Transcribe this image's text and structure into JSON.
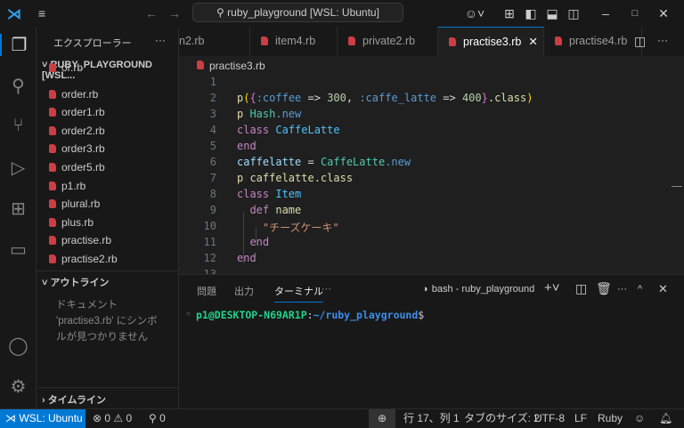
{
  "titlebar": {
    "search": "ruby_playground [WSL: Ubuntu]"
  },
  "sidebar": {
    "title": "エクスプローラー",
    "more": "···",
    "folder": "RUBY_PLAYGROUND [WSL...",
    "files": [
      "or.rb",
      "order.rb",
      "order1.rb",
      "order2.rb",
      "order3.rb",
      "order5.rb",
      "p1.rb",
      "plural.rb",
      "plus.rb",
      "practise.rb",
      "practise2.rb"
    ],
    "outline_title": "アウトライン",
    "outline_msg": [
      "ドキュメント",
      "'practise3.rb' にシンボ",
      "ルが見つかりません"
    ],
    "timeline_title": "タイムライン"
  },
  "tabs": [
    {
      "label": "n2.rb",
      "icon": false
    },
    {
      "label": "item4.rb",
      "icon": true
    },
    {
      "label": "private2.rb",
      "icon": true
    },
    {
      "label": "practise3.rb",
      "icon": true,
      "active": true
    },
    {
      "label": "practise4.rb",
      "icon": true
    }
  ],
  "breadcrumb": "practise3.rb",
  "code": [
    [],
    [
      [
        "p",
        "#dcdcaa"
      ],
      [
        "(",
        "#ffd700"
      ],
      [
        "{",
        "#da70d6"
      ],
      [
        ":coffee",
        "#569cd6"
      ],
      [
        " => ",
        "#d4d4d4"
      ],
      [
        "300",
        "#b5cea8"
      ],
      [
        ", ",
        "#d4d4d4"
      ],
      [
        ":caffe_latte",
        "#569cd6"
      ],
      [
        " => ",
        "#d4d4d4"
      ],
      [
        "400",
        "#b5cea8"
      ],
      [
        "}",
        "#da70d6"
      ],
      [
        ".class",
        "#dcdcaa"
      ],
      [
        ")",
        "#ffd700"
      ]
    ],
    [
      [
        "p ",
        "#dcdcaa"
      ],
      [
        "Hash",
        "#4ec9b0"
      ],
      [
        ".new",
        "#569cd6"
      ]
    ],
    [
      [
        "class ",
        "#c586c0"
      ],
      [
        "CaffeLatte",
        "#4fc1ff"
      ]
    ],
    [
      [
        "end",
        "#c586c0"
      ]
    ],
    [
      [
        "caffelatte",
        "#9cdcfe"
      ],
      [
        " = ",
        "#d4d4d4"
      ],
      [
        "CaffeLatte",
        "#4ec9b0"
      ],
      [
        ".new",
        "#569cd6"
      ]
    ],
    [
      [
        "p caffelatte.class",
        "#dcdcaa"
      ]
    ],
    [
      [
        "class ",
        "#c586c0"
      ],
      [
        "Item",
        "#4fc1ff"
      ]
    ],
    [
      [
        "  def ",
        "#c586c0"
      ],
      [
        "name",
        "#dcdcaa"
      ]
    ],
    [
      [
        "    \"チーズケーキ\"",
        "#ce9178"
      ]
    ],
    [
      [
        "  end",
        "#c586c0"
      ]
    ],
    [
      [
        "end",
        "#c586c0"
      ]
    ]
  ],
  "panel": {
    "tabs": [
      "問題",
      "出力",
      "ターミナル"
    ],
    "more": "···",
    "terminal_name": "bash - ruby_playground",
    "prompt_user": "p1@DESKTOP-N69AR1P",
    "prompt_sep": ":",
    "prompt_path": "~/ruby_playground",
    "prompt_end": "$"
  },
  "status": {
    "remote": "WSL: Ubuntu",
    "errors": "0",
    "warnings": "0",
    "ports": "0",
    "position": "行 17、列 1",
    "tabsize": "タブのサイズ: 2",
    "encoding": "UTF-8",
    "eol": "LF",
    "language": "Ruby"
  }
}
